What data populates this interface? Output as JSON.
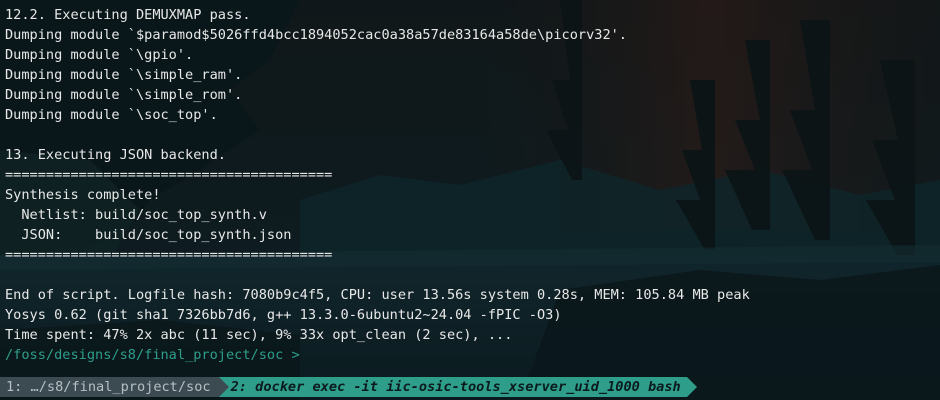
{
  "terminal": {
    "lines": [
      "12.2. Executing DEMUXMAP pass.",
      "Dumping module `$paramod$5026ffd4bcc1894052cac0a38a57de83164a58de\\picorv32'.",
      "Dumping module `\\gpio'.",
      "Dumping module `\\simple_ram'.",
      "Dumping module `\\simple_rom'.",
      "Dumping module `\\soc_top'.",
      "",
      "13. Executing JSON backend.",
      "========================================",
      "Synthesis complete!",
      "  Netlist: build/soc_top_synth.v",
      "  JSON:    build/soc_top_synth.json",
      "========================================",
      "",
      "End of script. Logfile hash: 7080b9c4f5, CPU: user 13.56s system 0.28s, MEM: 105.84 MB peak",
      "Yosys 0.62 (git sha1 7326bb7d6, g++ 13.3.0-6ubuntu2~24.04 -fPIC -O3)",
      "Time spent: 47% 2x abc (11 sec), 9% 33x opt_clean (2 sec), ..."
    ],
    "prompt": "/foss/designs/s8/final_project/soc >"
  },
  "statusbar": {
    "tab1": "1: …/s8/final_project/soc",
    "tab2": "2: docker exec -it iic-osic-tools_xserver_uid_1000 bash"
  },
  "colors": {
    "background": "#0e1b22",
    "text": "#e8e8e8",
    "prompt": "#2e9e8a",
    "tab_inactive_bg": "#3c4a52",
    "tab_active_bg": "#2e9e8a"
  }
}
